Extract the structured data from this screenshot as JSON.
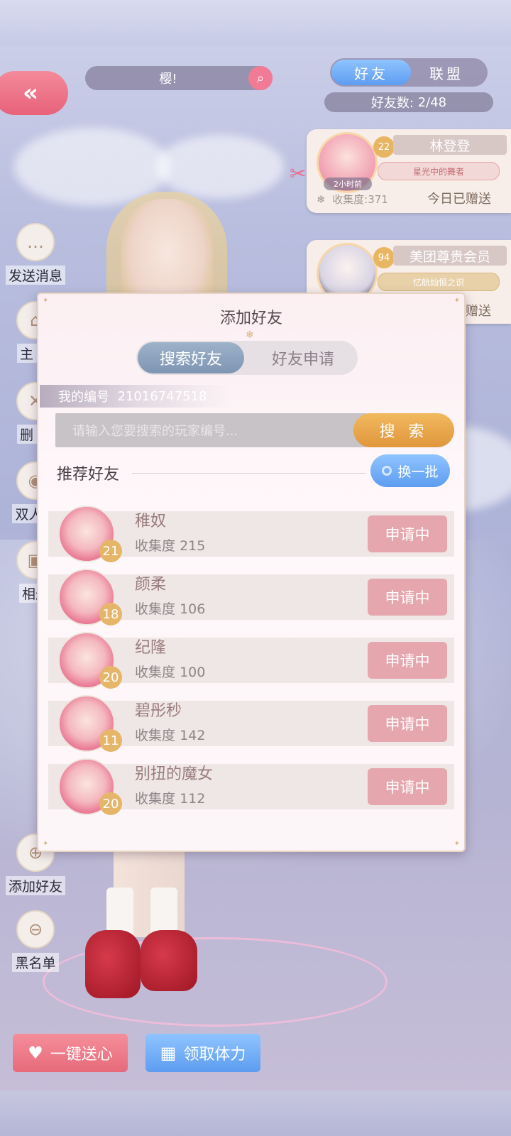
{
  "header": {
    "search_value": "樱!",
    "tabs": [
      "好友",
      "联盟"
    ],
    "active_tab": "好友",
    "friend_count_label": "好友数:",
    "friend_count": "2/48"
  },
  "friends": [
    {
      "level": "22",
      "name": "林登登",
      "title": "星光中的舞者",
      "time": "2小时前",
      "collect_label": "收集度:",
      "collect": "371",
      "gift_status": "今日已赠送"
    },
    {
      "level": "94",
      "name": "美团尊贵会员",
      "title": "忆航灿恒之识",
      "gift_status": "赠送"
    }
  ],
  "sidebar": [
    {
      "label": "发送消息",
      "icon": "chat-icon"
    },
    {
      "label": "主 页",
      "icon": "home-icon"
    },
    {
      "label": "删 除",
      "icon": "delete-icon"
    },
    {
      "label": "双人合",
      "icon": "camera-icon"
    },
    {
      "label": "相册",
      "icon": "album-icon"
    },
    {
      "label": "添加好友",
      "icon": "add-icon"
    },
    {
      "label": "黑名单",
      "icon": "block-icon"
    }
  ],
  "dialog": {
    "title": "添加好友",
    "tabs": [
      "搜索好友",
      "好友申请"
    ],
    "active_tab": "搜索好友",
    "my_id_label": "我的编号",
    "my_id": "21016747518",
    "search_placeholder": "请输入您要搜索的玩家编号...",
    "search_button": "搜 索",
    "recommend_label": "推荐好友",
    "refresh_button": "换一批",
    "recommended": [
      {
        "name": "稚奴",
        "collect_label": "收集度",
        "collect": "215",
        "level": "21",
        "status": "申请中"
      },
      {
        "name": "颜柔",
        "collect_label": "收集度",
        "collect": "106",
        "level": "18",
        "status": "申请中"
      },
      {
        "name": "纪隆",
        "collect_label": "收集度",
        "collect": "100",
        "level": "20",
        "status": "申请中"
      },
      {
        "name": "碧彤秒",
        "collect_label": "收集度",
        "collect": "142",
        "level": "11",
        "status": "申请中"
      },
      {
        "name": "别扭的魔女",
        "collect_label": "收集度",
        "collect": "112",
        "level": "20",
        "status": "申请中"
      }
    ]
  },
  "bottom": {
    "send_heart": "一键送心",
    "claim_stamina": "领取体力"
  },
  "colors": {
    "accent_pink": "#e66a7a",
    "accent_blue": "#5d9cf0",
    "accent_gold": "#e0963c"
  }
}
